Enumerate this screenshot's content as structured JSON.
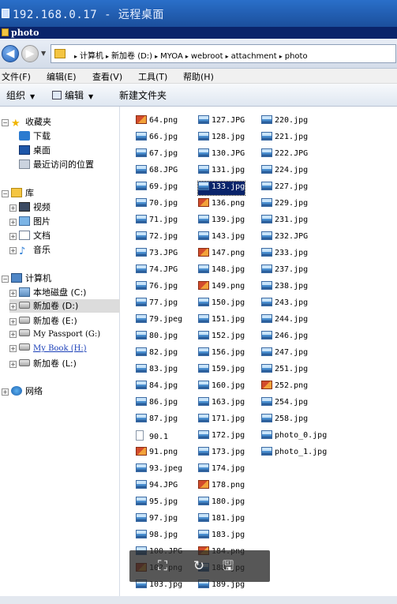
{
  "remote_window": {
    "title": "192.168.0.17 - 远程桌面"
  },
  "window": {
    "title": "photo"
  },
  "address": {
    "segments": [
      "计算机",
      "新加卷 (D:)",
      "MYOA",
      "webroot",
      "attachment",
      "photo"
    ]
  },
  "menu": [
    "文件(F)",
    "编辑(E)",
    "查看(V)",
    "工具(T)",
    "帮助(H)"
  ],
  "toolbar": {
    "organize": "组织",
    "edit": "编辑",
    "new_folder": "新建文件夹"
  },
  "nav": {
    "favorites": "收藏夹",
    "downloads": "下载",
    "desktop": "桌面",
    "recent": "最近访问的位置",
    "libraries": "库",
    "videos": "视频",
    "pictures": "图片",
    "documents": "文档",
    "music": "音乐",
    "computer": "计算机",
    "drive_c": "本地磁盘 (C:)",
    "drive_d": "新加卷 (D:)",
    "drive_e": "新加卷 (E:)",
    "drive_g": "My Passport (G:)",
    "drive_h": "My Book (H:)",
    "drive_l": "新加卷 (L:)",
    "network": "网络"
  },
  "files": {
    "col1": [
      {
        "name": "64.png",
        "type": "png"
      },
      {
        "name": "66.jpg",
        "type": "jpg"
      },
      {
        "name": "67.jpg",
        "type": "jpg"
      },
      {
        "name": "68.JPG",
        "type": "jpg"
      },
      {
        "name": "69.jpg",
        "type": "jpg"
      },
      {
        "name": "70.jpg",
        "type": "jpg"
      },
      {
        "name": "71.jpg",
        "type": "jpg"
      },
      {
        "name": "72.jpg",
        "type": "jpg"
      },
      {
        "name": "73.JPG",
        "type": "jpg"
      },
      {
        "name": "74.JPG",
        "type": "jpg"
      },
      {
        "name": "76.jpg",
        "type": "jpg"
      },
      {
        "name": "77.jpg",
        "type": "jpg"
      },
      {
        "name": "79.jpeg",
        "type": "jpg"
      },
      {
        "name": "80.jpg",
        "type": "jpg"
      },
      {
        "name": "82.jpg",
        "type": "jpg"
      },
      {
        "name": "83.jpg",
        "type": "jpg"
      },
      {
        "name": "84.jpg",
        "type": "jpg"
      },
      {
        "name": "86.jpg",
        "type": "jpg"
      },
      {
        "name": "87.jpg",
        "type": "jpg"
      },
      {
        "name": "90.1",
        "type": "blank"
      },
      {
        "name": "91.png",
        "type": "png"
      },
      {
        "name": "93.jpeg",
        "type": "jpg"
      },
      {
        "name": "94.JPG",
        "type": "jpg"
      },
      {
        "name": "95.jpg",
        "type": "jpg"
      },
      {
        "name": "97.jpg",
        "type": "jpg"
      },
      {
        "name": "98.jpg",
        "type": "jpg"
      },
      {
        "name": "100.JPG",
        "type": "jpg"
      },
      {
        "name": "10?.png",
        "type": "png"
      },
      {
        "name": "103.jpg",
        "type": "jpg"
      }
    ],
    "col2": [
      {
        "name": "127.JPG",
        "type": "jpg"
      },
      {
        "name": "128.jpg",
        "type": "jpg"
      },
      {
        "name": "130.JPG",
        "type": "jpg"
      },
      {
        "name": "131.jpg",
        "type": "jpg"
      },
      {
        "name": "133.jpg",
        "type": "jpg",
        "selected": true
      },
      {
        "name": "136.png",
        "type": "png"
      },
      {
        "name": "139.jpg",
        "type": "jpg"
      },
      {
        "name": "143.jpg",
        "type": "jpg"
      },
      {
        "name": "147.png",
        "type": "png"
      },
      {
        "name": "148.jpg",
        "type": "jpg"
      },
      {
        "name": "149.png",
        "type": "png"
      },
      {
        "name": "150.jpg",
        "type": "jpg"
      },
      {
        "name": "151.jpg",
        "type": "jpg"
      },
      {
        "name": "152.jpg",
        "type": "jpg"
      },
      {
        "name": "156.jpg",
        "type": "jpg"
      },
      {
        "name": "159.jpg",
        "type": "jpg"
      },
      {
        "name": "160.jpg",
        "type": "jpg"
      },
      {
        "name": "163.jpg",
        "type": "jpg"
      },
      {
        "name": "171.jpg",
        "type": "jpg"
      },
      {
        "name": "172.jpg",
        "type": "jpg"
      },
      {
        "name": "173.jpg",
        "type": "jpg"
      },
      {
        "name": "174.jpg",
        "type": "jpg"
      },
      {
        "name": "178.png",
        "type": "png"
      },
      {
        "name": "180.jpg",
        "type": "jpg"
      },
      {
        "name": "181.jpg",
        "type": "jpg"
      },
      {
        "name": "183.jpg",
        "type": "jpg"
      },
      {
        "name": "184.png",
        "type": "png"
      },
      {
        "name": "188.jpg",
        "type": "jpg"
      },
      {
        "name": "189.jpg",
        "type": "jpg"
      }
    ],
    "col3": [
      {
        "name": "220.jpg",
        "type": "jpg"
      },
      {
        "name": "221.jpg",
        "type": "jpg"
      },
      {
        "name": "222.JPG",
        "type": "jpg"
      },
      {
        "name": "224.jpg",
        "type": "jpg"
      },
      {
        "name": "227.jpg",
        "type": "jpg"
      },
      {
        "name": "229.jpg",
        "type": "jpg"
      },
      {
        "name": "231.jpg",
        "type": "jpg"
      },
      {
        "name": "232.JPG",
        "type": "jpg"
      },
      {
        "name": "233.jpg",
        "type": "jpg"
      },
      {
        "name": "237.jpg",
        "type": "jpg"
      },
      {
        "name": "238.jpg",
        "type": "jpg"
      },
      {
        "name": "243.jpg",
        "type": "jpg"
      },
      {
        "name": "244.jpg",
        "type": "jpg"
      },
      {
        "name": "246.jpg",
        "type": "jpg"
      },
      {
        "name": "247.jpg",
        "type": "jpg"
      },
      {
        "name": "251.jpg",
        "type": "jpg"
      },
      {
        "name": "252.png",
        "type": "png"
      },
      {
        "name": "254.jpg",
        "type": "jpg"
      },
      {
        "name": "258.jpg",
        "type": "jpg"
      },
      {
        "name": "photo_0.jpg",
        "type": "jpg"
      },
      {
        "name": "photo_1.jpg",
        "type": "jpg"
      }
    ]
  },
  "overlay_icons": [
    "fullscreen-icon",
    "rotate-icon",
    "save-icon"
  ]
}
